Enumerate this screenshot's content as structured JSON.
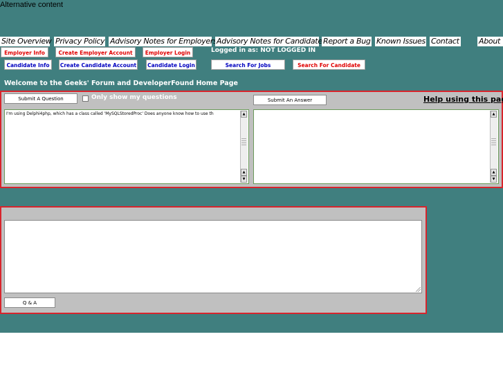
{
  "alt_text": "Alternative content",
  "nav": [
    {
      "label": "Site Overview"
    },
    {
      "label": "Privacy Policy"
    },
    {
      "label": "Advisory Notes for Employers"
    },
    {
      "label": "Advisory Notes for Candidates"
    },
    {
      "label": "Report a Bug"
    },
    {
      "label": "Known Issues"
    },
    {
      "label": "Contact"
    },
    {
      "label": "About"
    }
  ],
  "employer": {
    "info": "Employer Info",
    "create": "Create Employer Account",
    "login": "Employer Login"
  },
  "candidate": {
    "info": "Candidate Info",
    "create": "Create Candidate Account",
    "login": "Candidate Login"
  },
  "search": {
    "jobs": "Search For Jobs",
    "candidate": "Search For Candidate"
  },
  "status": "Logged in as: NOT LOGGED IN",
  "welcome": "Welcome to the Geeks' Forum and DeveloperFound Home Page",
  "forum": {
    "submit_question": "Submit A Question",
    "only_mine": "Only show my questions",
    "submit_answer": "Submit An Answer",
    "help": "Help using this page",
    "question_text": "I'm using Delphi4php, which has a class called 'MySQLStoredProc' Does anyone know how to use th",
    "answer_text": ""
  },
  "qa": {
    "text": "",
    "button": "Q & A"
  },
  "colors": {
    "background": "#407f7f",
    "panel": "#c0c0c0",
    "panel_border": "#d8242c",
    "employer_text": "#e00000",
    "candidate_text": "#0000c0"
  }
}
